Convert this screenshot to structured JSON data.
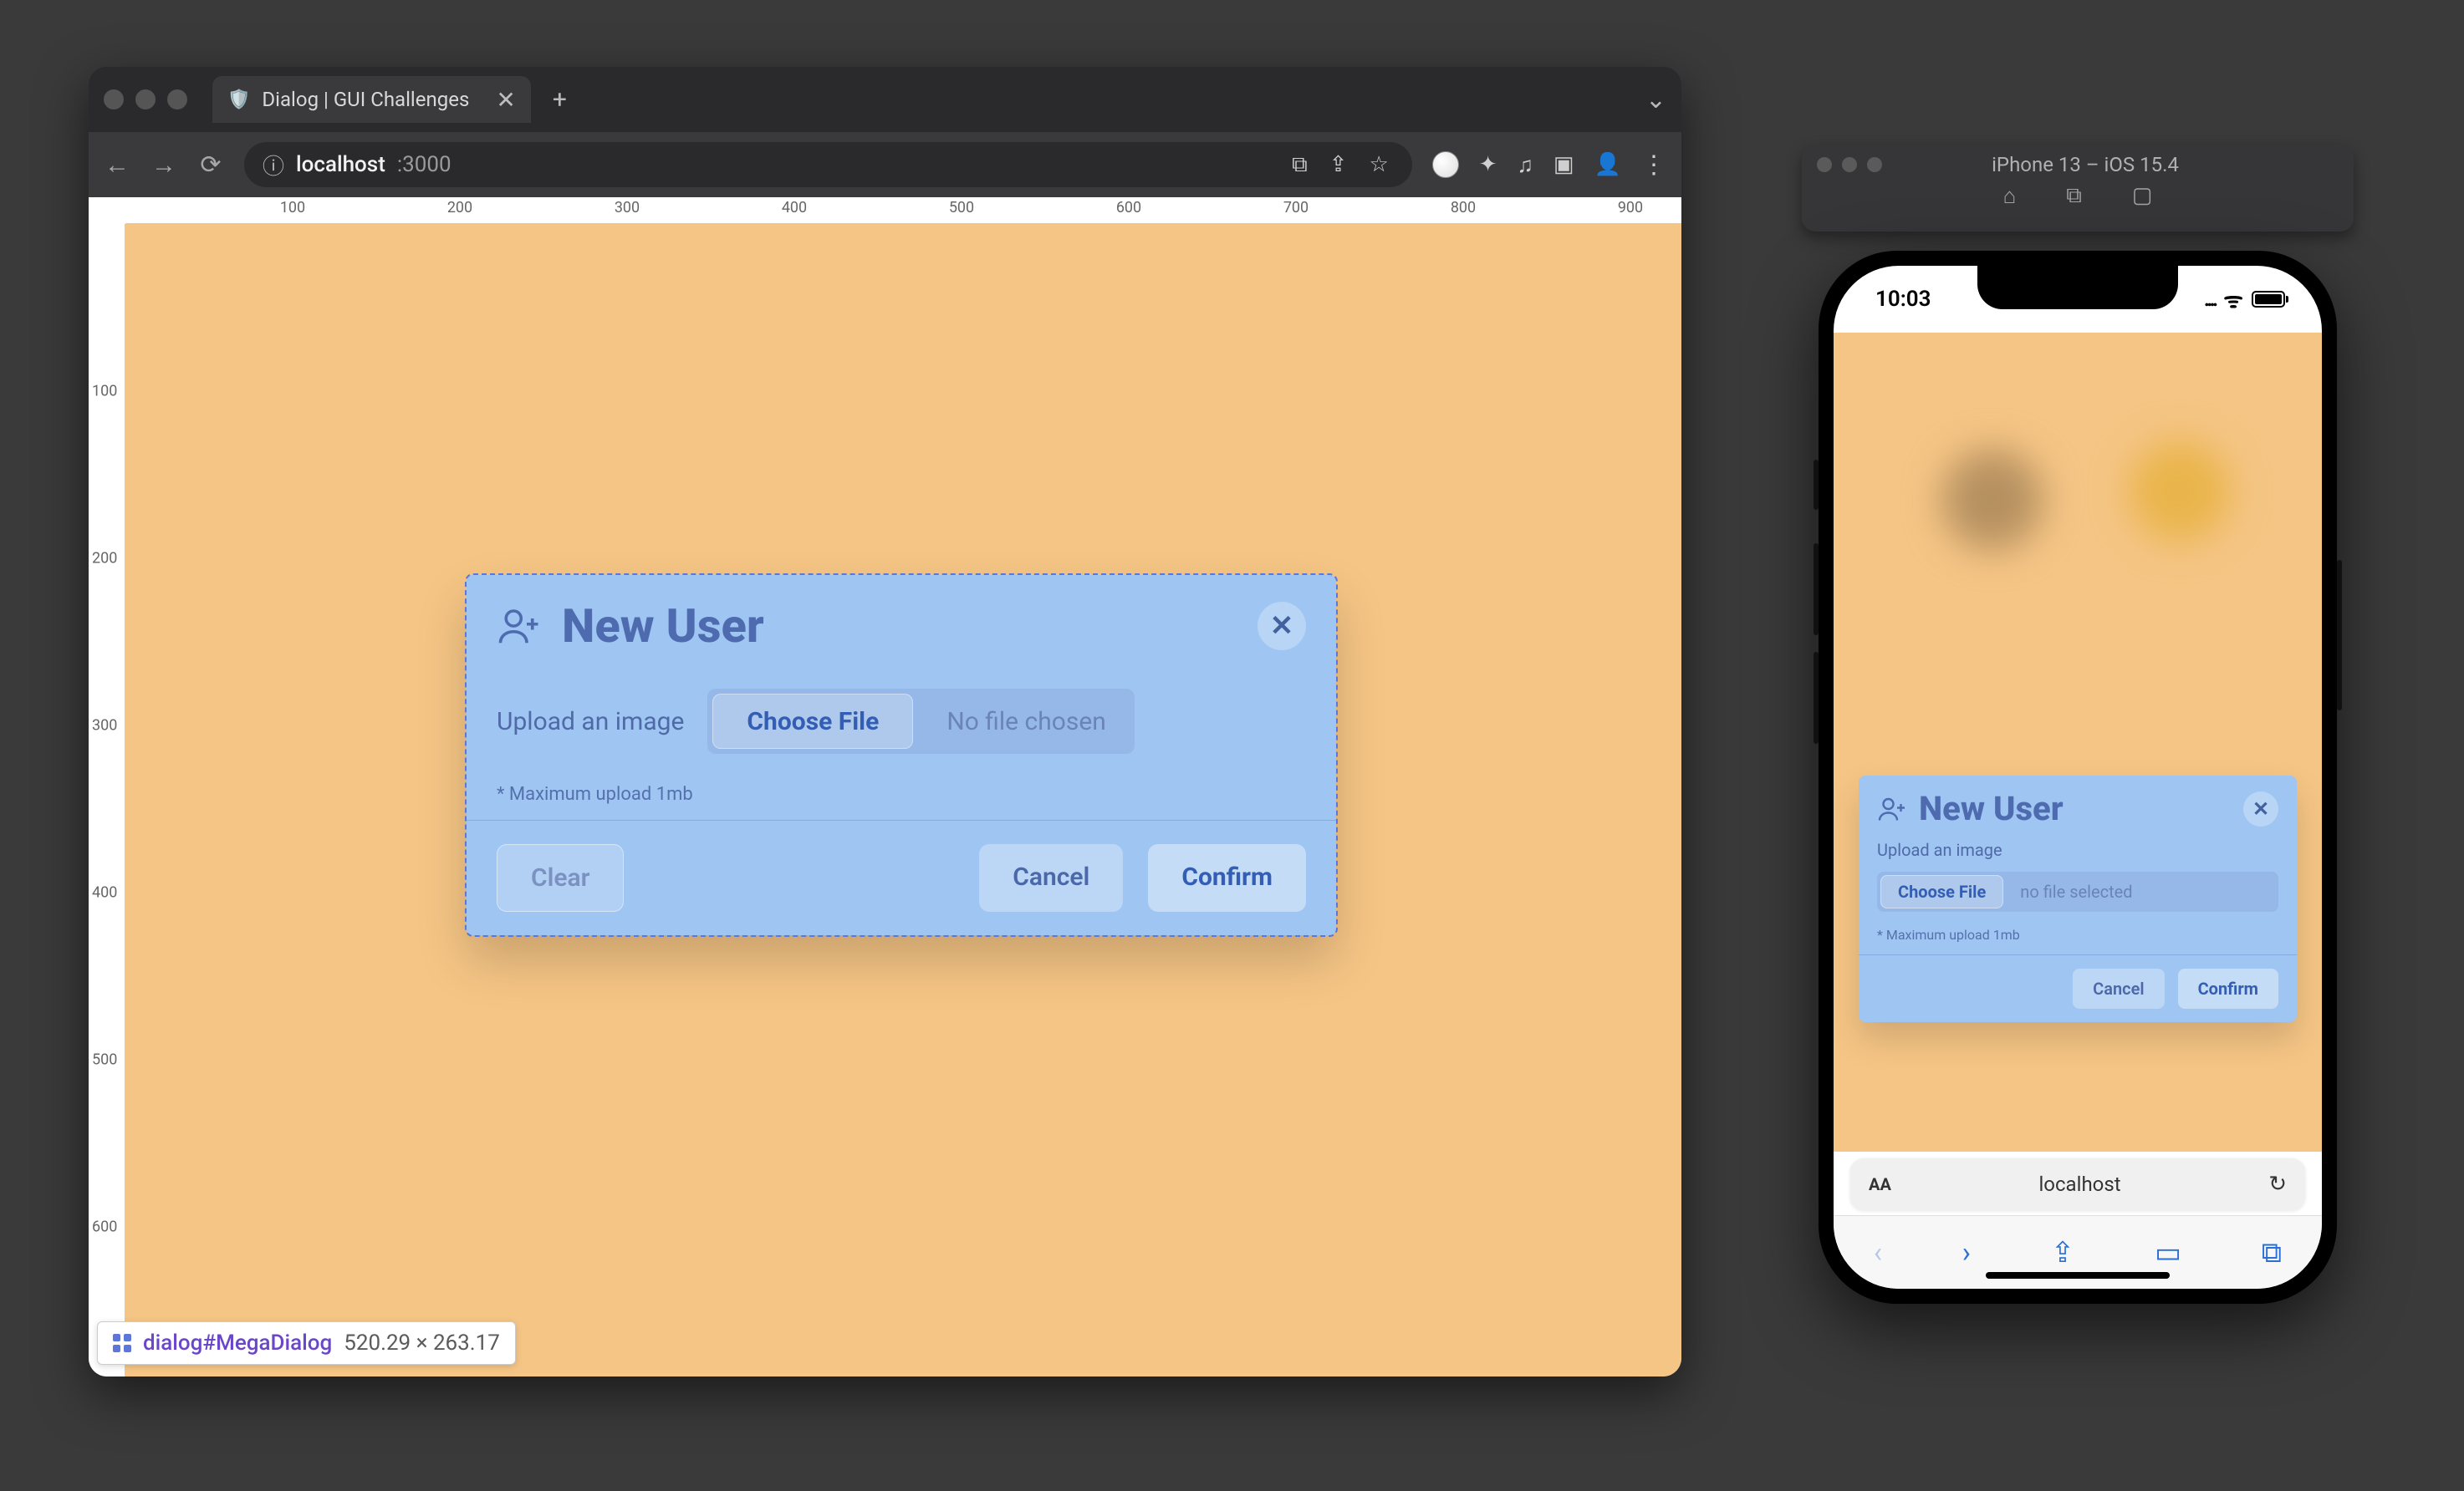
{
  "browser": {
    "tab": {
      "title": "Dialog | GUI Challenges",
      "favicon": "🛡️"
    },
    "url": {
      "info_icon": "ⓘ",
      "host": "localhost",
      "port": ":3000"
    },
    "toolbar_icons": {
      "back": "←",
      "forward": "→",
      "reload": "⟳",
      "open_external": "⧉",
      "share": "⇪",
      "star": "☆",
      "compass": "🧭",
      "extension": "✦",
      "equalizer": "♫",
      "devices": "▣",
      "avatar": "👤",
      "menu": "⋮",
      "new_tab": "+",
      "close_tab": "✕",
      "tabs_dropdown": "⌄"
    }
  },
  "ruler": {
    "h": [
      "100",
      "200",
      "300",
      "400",
      "500",
      "600",
      "700",
      "800",
      "900"
    ],
    "v": [
      "100",
      "200",
      "300",
      "400",
      "500",
      "600"
    ]
  },
  "dialog": {
    "title": "New User",
    "upload_label": "Upload an image",
    "choose_file": "Choose File",
    "no_file": "No file chosen",
    "hint": "* Maximum upload 1mb",
    "clear": "Clear",
    "cancel": "Cancel",
    "confirm": "Confirm"
  },
  "elem_badge": {
    "selector": "dialog#MegaDialog",
    "dims": "520.29 × 263.17"
  },
  "simulator": {
    "title": "iPhone 13 – iOS 15.4",
    "icons": {
      "home": "⌂",
      "screenshot": "⧉",
      "rotate": "▢"
    }
  },
  "phone": {
    "status": {
      "time": "10:03",
      "signal": "▮▮▮▮",
      "wifi": "ᯤ"
    },
    "dialog": {
      "title": "New User",
      "upload_label": "Upload an image",
      "choose_file": "Choose File",
      "no_file": "no file selected",
      "hint": "* Maximum upload 1mb",
      "cancel": "Cancel",
      "confirm": "Confirm"
    },
    "safari": {
      "aa": "AA",
      "location": "localhost",
      "reload": "↻",
      "back": "‹",
      "forward": "›",
      "share": "⇪",
      "bookmarks": "▭",
      "tabs": "⧉"
    }
  }
}
